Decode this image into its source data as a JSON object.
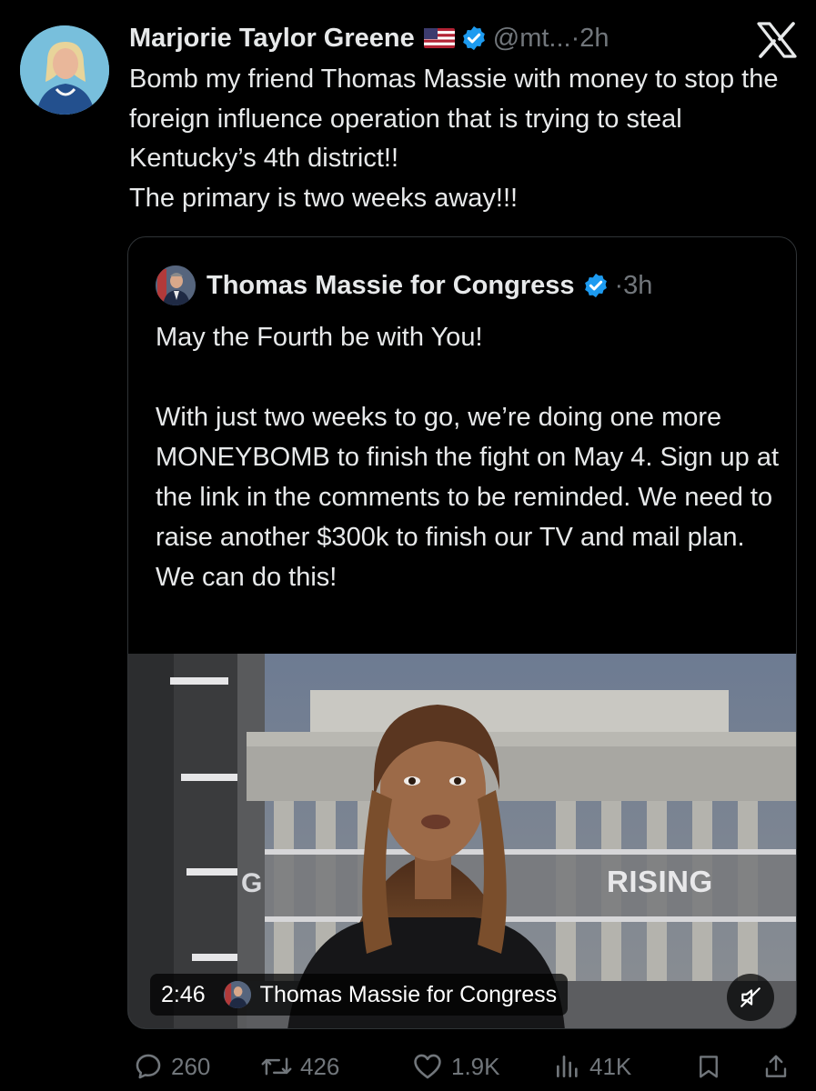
{
  "tweet": {
    "author_name": "Marjorie Taylor Greene",
    "handle": "@mt...",
    "separator": "·",
    "time": "2h",
    "text": "Bomb my friend Thomas Massie with money to stop the foreign influence operation that is trying to steal Kentucky’s 4th district!!\nThe primary is two weeks away!!!"
  },
  "quote": {
    "author_name": "Thomas Massie for Congress",
    "separator": "·",
    "time": "3h",
    "text": "May the Fourth be with You!\n\nWith just two weeks to go, we’re doing one more MONEYBOMB to finish the fight on May 4. Sign up at the link in the comments to be reminded. We need to raise another $300k to finish our TV and mail plan. We can do this!",
    "video": {
      "duration": "2:46",
      "channel_name": "Thomas Massie for Congress",
      "overlay_text": "RISING",
      "overlay_fragment": "G"
    }
  },
  "actions": {
    "replies": "260",
    "reposts": "426",
    "likes": "1.9K",
    "views": "41K"
  },
  "colors": {
    "background": "#000000",
    "text_primary": "#e7e9ea",
    "text_secondary": "#71767b",
    "verified_blue": "#1d9bf0",
    "border": "#2f3336"
  },
  "icons": [
    "x-logo-icon",
    "us-flag-icon",
    "verified-badge-icon",
    "reply-icon",
    "repost-icon",
    "like-icon",
    "views-icon",
    "bookmark-icon",
    "share-icon",
    "mute-icon"
  ]
}
